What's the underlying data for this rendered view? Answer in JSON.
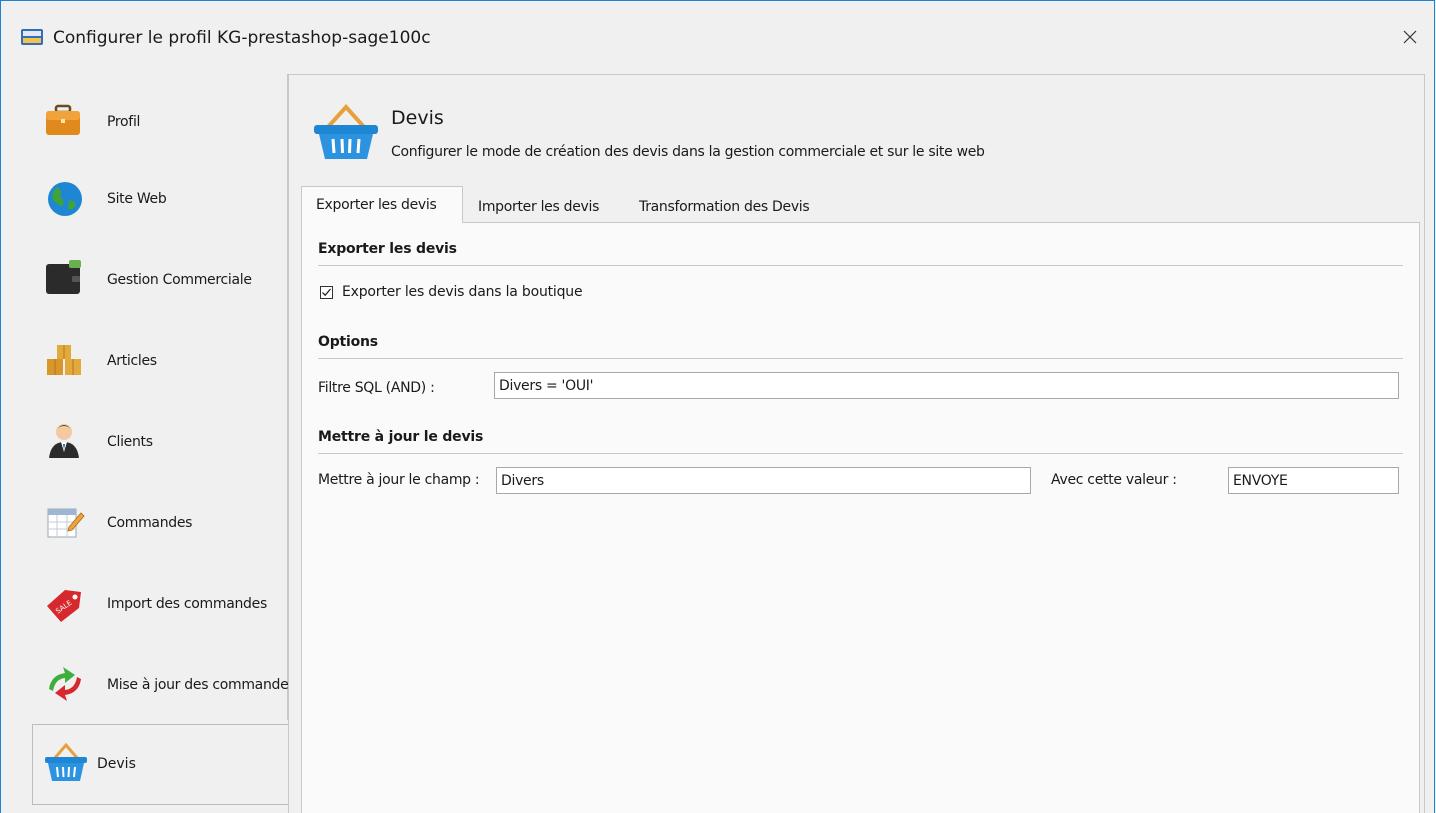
{
  "window": {
    "title": "Configurer le profil KG-prestashop-sage100c",
    "app_icon": "alert-sync-icon"
  },
  "sidebar": {
    "items": [
      {
        "label": "Profil",
        "icon": "briefcase-icon"
      },
      {
        "label": "Site Web",
        "icon": "globe-icon"
      },
      {
        "label": "Gestion Commerciale",
        "icon": "wallet-icon"
      },
      {
        "label": "Articles",
        "icon": "boxes-icon"
      },
      {
        "label": "Clients",
        "icon": "user-icon"
      },
      {
        "label": "Commandes",
        "icon": "calendar-edit-icon"
      },
      {
        "label": "Import des commandes",
        "icon": "sale-tag-icon"
      },
      {
        "label": "Mise à jour des commandes",
        "icon": "sync-arrows-icon"
      }
    ],
    "selected": {
      "label": "Devis",
      "icon": "basket-icon"
    }
  },
  "header": {
    "title": "Devis",
    "description": "Configurer le mode de création des devis dans la gestion commerciale et sur le site web",
    "icon": "basket-icon"
  },
  "tabs": [
    {
      "label": "Exporter les devis",
      "active": true
    },
    {
      "label": "Importer les devis",
      "active": false
    },
    {
      "label": "Transformation des Devis",
      "active": false
    }
  ],
  "export_section": {
    "title": "Exporter les devis",
    "checkbox_label": "Exporter les devis dans la boutique",
    "checked": true
  },
  "options_section": {
    "title": "Options",
    "sql_filter_label": "Filtre SQL (AND) :",
    "sql_filter_value": "Divers = 'OUI'"
  },
  "update_section": {
    "title": "Mettre à jour le devis",
    "field_label": "Mettre à jour le champ :",
    "field_value": "Divers",
    "value_label": "Avec cette valeur :",
    "value_value": "ENVOYE"
  },
  "colors": {
    "window_border": "#1883d7",
    "background": "#f0f0f0",
    "panel": "#fafafa"
  }
}
